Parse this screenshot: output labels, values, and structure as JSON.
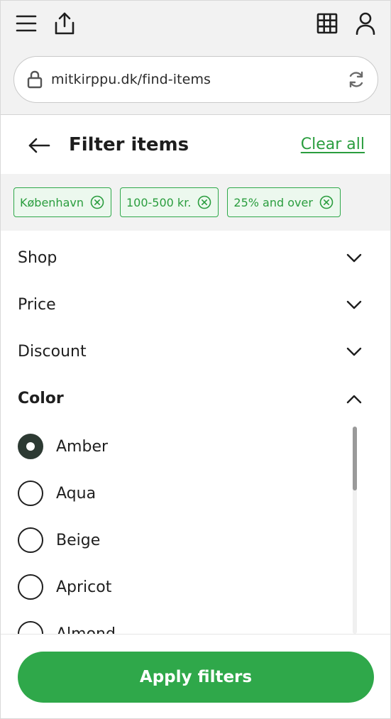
{
  "browser": {
    "url": "mitkirppu.dk/find-items",
    "icons": [
      "menu-icon",
      "share-icon",
      "grid-icon",
      "user-icon",
      "lock-icon",
      "reload-icon"
    ]
  },
  "header": {
    "title": "Filter items",
    "clear_all": "Clear all"
  },
  "chips": [
    {
      "label": "København"
    },
    {
      "label": "100-500 kr."
    },
    {
      "label": "25% and over"
    }
  ],
  "sections": {
    "shop": {
      "label": "Shop",
      "expanded": false
    },
    "price": {
      "label": "Price",
      "expanded": false
    },
    "discount": {
      "label": "Discount",
      "expanded": false
    },
    "color": {
      "label": "Color",
      "expanded": true
    }
  },
  "color_options": [
    {
      "label": "Amber",
      "selected": true
    },
    {
      "label": "Aqua",
      "selected": false
    },
    {
      "label": "Beige",
      "selected": false
    },
    {
      "label": "Apricot",
      "selected": false
    },
    {
      "label": "Almond",
      "selected": false
    }
  ],
  "footer": {
    "apply_label": "Apply filters"
  },
  "colors": {
    "accent": "#2fa84a",
    "chip_bg": "#ecf8ee",
    "radio_checked": "#2d3a33",
    "chrome_bg": "#f2f2f2"
  }
}
